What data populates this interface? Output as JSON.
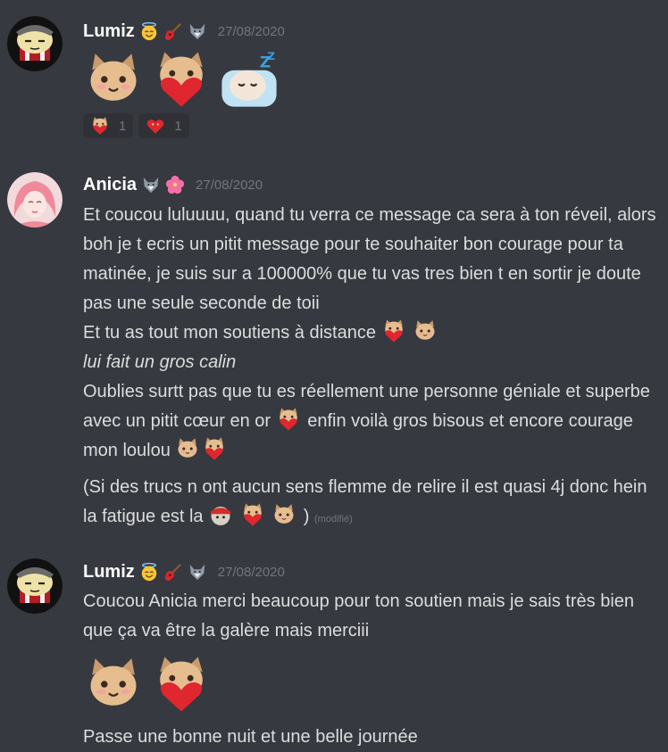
{
  "messages": [
    {
      "username": "Lumiz",
      "badges": [
        "angel-smile-icon",
        "guitar-icon",
        "wolf-icon"
      ],
      "timestamp": "27/08/2020",
      "emojis": [
        "cat-teary-cheeks-emoji",
        "cat-heart-emoji",
        "cat-sleeping-emoji"
      ],
      "reactions": [
        {
          "emoji": "cat-heart-emoji",
          "count": "1"
        },
        {
          "emoji": "heart-face-emoji",
          "count": "1"
        }
      ]
    },
    {
      "username": "Anicia",
      "badges": [
        "wolf-icon",
        "hibiscus-icon"
      ],
      "timestamp": "27/08/2020",
      "lines": [
        "Et coucou luluuuu, quand tu verra ce message ca sera à ton réveil, alors boh je t ecris un pitit message pour te souhaiter bon courage pour ta matinée, je suis sur a 100000% que tu vas tres bien t en sortir je doute pas une seule seconde de toii",
        "Et tu as tout mon soutiens à distance",
        "lui fait un gros calin",
        "Oublies surtt pas que tu es réellement une personne géniale et superbe avec un pitit cœur en or",
        "enfin voilà gros bisous et encore courage mon  loulou",
        "(Si des trucs n ont aucun sens flemme de relire il est quasi 4j donc hein la fatigue est la",
        ")",
        "(modifié)"
      ]
    },
    {
      "username": "Lumiz",
      "badges": [
        "angel-smile-icon",
        "guitar-icon",
        "wolf-icon"
      ],
      "timestamp": "27/08/2020",
      "lines": [
        "Coucou Anicia merci beaucoup pour ton soutien mais je sais très bien que ça va être la galère mais merciii",
        "Passe une bonne nuit et une belle journée"
      ],
      "emojis": [
        "cat-teary-cheeks-emoji",
        "cat-heart-emoji"
      ]
    }
  ],
  "colors": {
    "background": "#36393f",
    "username": "#ffffff",
    "text": "#dcddde",
    "muted": "#72767d",
    "reaction_bg": "#2f3136"
  }
}
